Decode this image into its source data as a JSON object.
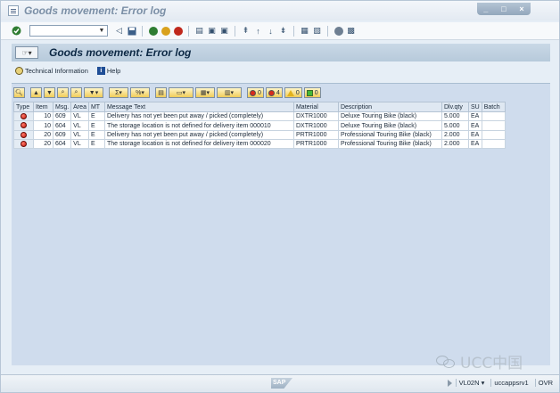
{
  "window": {
    "title": "Goods movement: Error log",
    "controls": [
      "_",
      "□",
      "×"
    ]
  },
  "std_toolbar": {
    "command_field_value": "",
    "icons": [
      "enter-icon",
      "back-icon",
      "save-icon",
      "back-nav-icon",
      "exit-icon",
      "cancel-icon",
      "print-icon",
      "find-icon",
      "find-next-icon",
      "first-page-icon",
      "previous-page-icon",
      "next-page-icon",
      "last-page-icon",
      "create-session-icon",
      "shortcut-icon",
      "help-icon",
      "layout-menu-icon"
    ]
  },
  "screen": {
    "title": "Goods movement: Error log"
  },
  "app_toolbar": {
    "technical_information": "Technical Information",
    "help": "Help"
  },
  "alv_toolbar": {
    "errors_count": "0",
    "warnings_count": "4",
    "info_count": "0",
    "success_count": "0"
  },
  "grid": {
    "columns": [
      "Type",
      "Item",
      "Msg.",
      "Area",
      "MT",
      "Message Text",
      "Material",
      "Description",
      "Dlv.qty",
      "SU",
      "Batch"
    ],
    "rows": [
      {
        "item": "10",
        "msg": "609",
        "area": "VL",
        "mt": "E",
        "text": "Delivery has not yet been put away / picked (completely)",
        "material": "DXTR1000",
        "description": "Deluxe Touring Bike (black)",
        "qty": "5.000",
        "su": "EA",
        "batch": ""
      },
      {
        "item": "10",
        "msg": "604",
        "area": "VL",
        "mt": "E",
        "text": "The storage location is not defined for delivery item 000010",
        "material": "DXTR1000",
        "description": "Deluxe Touring Bike (black)",
        "qty": "5.000",
        "su": "EA",
        "batch": ""
      },
      {
        "item": "20",
        "msg": "609",
        "area": "VL",
        "mt": "E",
        "text": "Delivery has not yet been put away / picked (completely)",
        "material": "PRTR1000",
        "description": "Professional Touring Bike (black)",
        "qty": "2.000",
        "su": "EA",
        "batch": ""
      },
      {
        "item": "20",
        "msg": "604",
        "area": "VL",
        "mt": "E",
        "text": "The storage location is not defined for delivery item 000020",
        "material": "PRTR1000",
        "description": "Professional Touring Bike (black)",
        "qty": "2.000",
        "su": "EA",
        "batch": ""
      }
    ]
  },
  "status_bar": {
    "sap_logo": "SAP",
    "transaction": "VL02N",
    "server": "uccappsrv1",
    "mode": "OVR"
  },
  "watermark": {
    "text": "UCC中国"
  }
}
